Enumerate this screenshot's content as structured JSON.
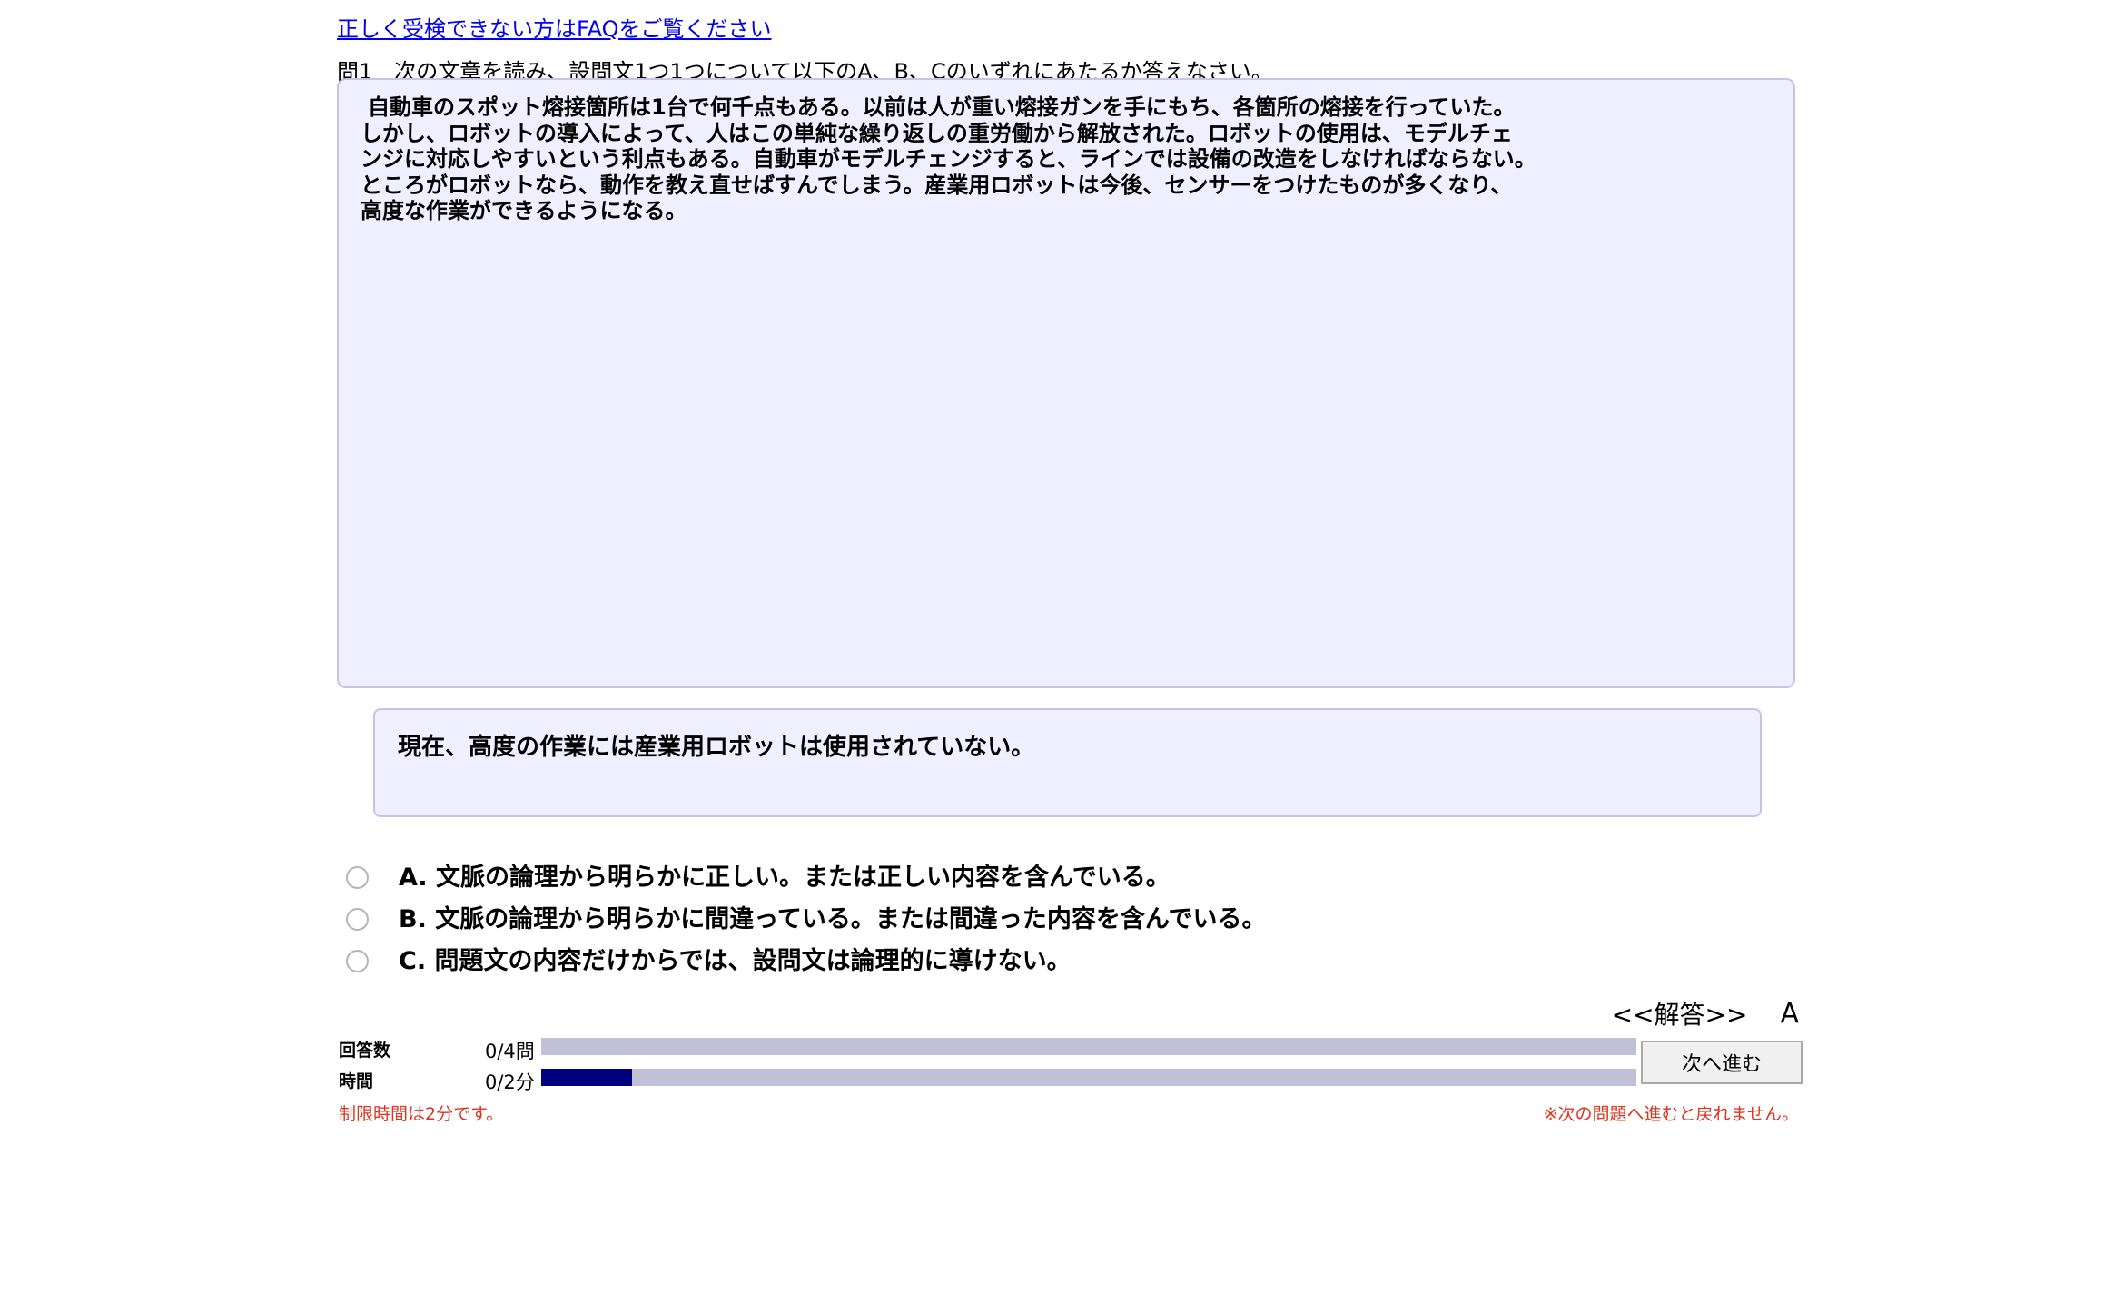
{
  "faq_link": "正しく受検できない方はFAQをご覧ください",
  "question": {
    "header": "問1　次の文章を読み、設問文1つ1つについて以下のA、B、Cのいずれにあたるか答えなさい。",
    "passage_lines": [
      "自動車のスポット熔接箇所は1台で何千点もある。以前は人が重い熔接ガンを手にもち、各箇所の熔接を行っていた。",
      "しかし、ロボットの導入によって、人はこの単純な繰り返しの重労働から解放された。ロボットの使用は、モデルチェ",
      "ンジに対応しやすいという利点もある。自動車がモデルチェンジすると、ラインでは設備の改造をしなければならない。",
      "ところがロボットなら、動作を教え直せばすんでしまう。産業用ロボットは今後、センサーをつけたものが多くなり、",
      "高度な作業ができるようになる。"
    ],
    "statement": "現在、高度の作業には産業用ロボットは使用されていない。"
  },
  "options": [
    {
      "label": "A. 文脈の論理から明らかに正しい。または正しい内容を含んでいる。"
    },
    {
      "label": "B. 文脈の論理から明らかに間違っている。または間違った内容を含んでいる。"
    },
    {
      "label": "C. 問題文の内容だけからでは、設問文は論理的に導けない。"
    }
  ],
  "answer": {
    "label": "<<解答>>",
    "value": "A"
  },
  "progress": {
    "answers": {
      "label": "回答数",
      "value": "0/4問",
      "fraction": 0
    },
    "time": {
      "label": "時間",
      "value": "0/2分",
      "fraction": 0.083
    }
  },
  "next_button": "次へ進む",
  "notes": {
    "time_limit": "制限時間は2分です。",
    "no_return": "※次の問題へ進むと戻れません。"
  },
  "colors": {
    "box_background": "#efefff",
    "box_border": "#c4c4e6",
    "bar_track": "#c0c0d6",
    "bar_fill": "#00007f",
    "link": "#0000ee",
    "note": "#e0321e"
  }
}
